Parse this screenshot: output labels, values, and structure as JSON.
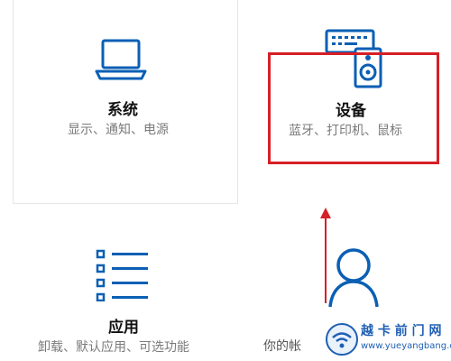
{
  "tiles": {
    "system": {
      "title": "系统",
      "desc": "显示、通知、电源",
      "icon": "laptop-icon"
    },
    "devices": {
      "title": "设备",
      "desc": "蓝牙、打印机、鼠标",
      "icon": "devices-icon"
    },
    "apps": {
      "title": "应用",
      "desc": "卸载、默认应用、可选功能",
      "icon": "apps-list-icon"
    },
    "accounts": {
      "desc_partial": "你的帐",
      "icon": "person-icon"
    }
  },
  "annotation": {
    "highlight_color": "#d61f26"
  },
  "watermark": {
    "site_name": "越 卡 前 门 网",
    "url": "www.yueyangbang.com"
  },
  "colors": {
    "accent": "#0a5fb4"
  }
}
